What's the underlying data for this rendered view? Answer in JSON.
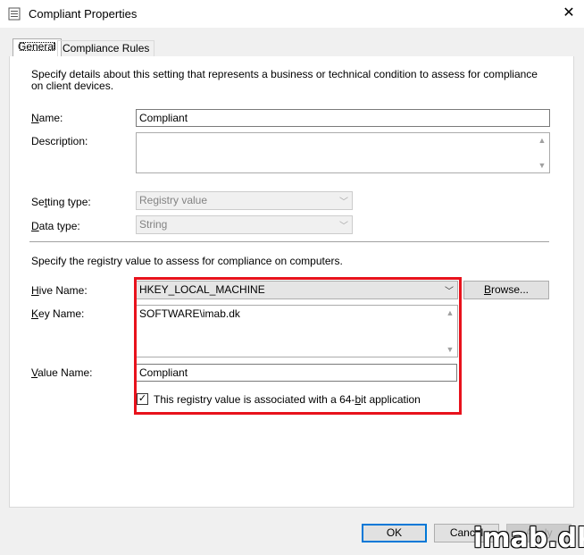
{
  "window": {
    "title": "Compliant Properties",
    "close_symbol": "✕"
  },
  "tabs": [
    {
      "label": "General"
    },
    {
      "label": "Compliance Rules"
    }
  ],
  "intro_text": "Specify details about this setting that represents a business or technical condition to assess for compliance on client devices.",
  "fields": {
    "name": {
      "label_u": "N",
      "label_rest": "ame:",
      "value": "Compliant"
    },
    "description": {
      "label": "Description:",
      "value": ""
    },
    "setting_type": {
      "label_pre": "Se",
      "label_u": "t",
      "label_rest": "ting type:",
      "value": "Registry value"
    },
    "data_type": {
      "label_u": "D",
      "label_rest": "ata type:",
      "value": "String"
    }
  },
  "registry_section_text": "Specify the registry value to assess for compliance on computers.",
  "registry": {
    "hive": {
      "label_u": "H",
      "label_rest": "ive Name:",
      "value": "HKEY_LOCAL_MACHINE"
    },
    "browse_button": {
      "label_u": "B",
      "label_rest": "rowse..."
    },
    "key": {
      "label_u": "K",
      "label_rest": "ey Name:",
      "value": "SOFTWARE\\imab.dk"
    },
    "value_name": {
      "label_u": "V",
      "label_rest": "alue Name:",
      "value": "Compliant"
    },
    "checkbox": {
      "label_pre": "This registry value is associated with a 64-",
      "label_u": "b",
      "label_rest": "it application",
      "checked": true
    }
  },
  "buttons": {
    "ok": "OK",
    "cancel": "Cancel",
    "apply": "Apply"
  },
  "watermark": "imab.dk",
  "colors": {
    "highlight_border": "#e8121c",
    "default_button_border": "#0078d7"
  }
}
